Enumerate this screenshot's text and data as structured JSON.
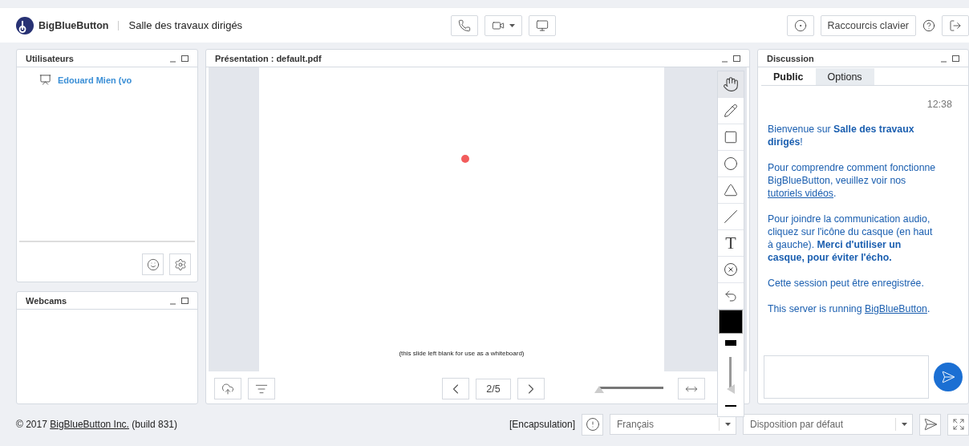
{
  "header": {
    "brand": "BigBlueButton",
    "room": "Salle des travaux dirigés",
    "media_buttons": [
      {
        "kind": "phone"
      },
      {
        "kind": "camera"
      },
      {
        "kind": "screen"
      }
    ],
    "shortcuts": "Raccourcis clavier"
  },
  "users_panel": {
    "title": "Utilisateurs",
    "users": [
      {
        "name": "Edouard Mien (vo",
        "presenter": true
      }
    ]
  },
  "webcams_panel": {
    "title": "Webcams"
  },
  "presentation": {
    "title": "Présentation : default.pdf",
    "slide_caption": "(this slide left blank for use as a whiteboard)",
    "page": "2/5",
    "zoom": {
      "level": 0
    },
    "tools": [
      {
        "kind": "hand",
        "selected": true
      },
      {
        "kind": "pencil",
        "selected": false
      },
      {
        "kind": "rectangle",
        "selected": false
      },
      {
        "kind": "ellipse",
        "selected": false
      },
      {
        "kind": "triangle",
        "selected": false
      },
      {
        "kind": "line",
        "selected": false
      },
      {
        "kind": "text",
        "label": "T",
        "selected": false
      },
      {
        "kind": "clear",
        "selected": false
      },
      {
        "kind": "undo",
        "selected": false
      }
    ],
    "pen_color": {
      "color": "#000000"
    },
    "thickness": {
      "level": 0
    }
  },
  "chat": {
    "title": "Discussion",
    "tabs": [
      {
        "label": "Public",
        "selected": true
      },
      {
        "label": "Options",
        "selected": false
      }
    ],
    "time": "12:38",
    "messages": [
      [
        {
          "kind": "text",
          "text": "Bienvenue sur "
        },
        {
          "kind": "bold",
          "text": "Salle des travaux dirigés"
        },
        {
          "kind": "text",
          "text": "!"
        }
      ],
      [
        {
          "kind": "text",
          "text": "Pour comprendre comment fonctionne BigBlueButton, veuillez voir nos "
        },
        {
          "kind": "link",
          "text": "tutoriels vidéos"
        },
        {
          "kind": "text",
          "text": "."
        }
      ],
      [
        {
          "kind": "text",
          "text": "Pour joindre la communication audio, cliquez sur l'icône du casque (en haut à gauche). "
        },
        {
          "kind": "bold",
          "text": "Merci d'utiliser un casque, pour éviter l'écho."
        }
      ],
      [
        {
          "kind": "text",
          "text": "Cette session peut être enregistrée."
        }
      ],
      [
        {
          "kind": "text",
          "text": "This server is running "
        },
        {
          "kind": "link",
          "text": "BigBlueButton"
        },
        {
          "kind": "text",
          "text": "."
        }
      ]
    ]
  },
  "footer": {
    "copyright": "© 2017 ",
    "company": "BigBlueButton Inc.",
    "build": " (build 831)",
    "tag": "[Encapsulation]",
    "language": "Français",
    "layout": "Disposition par défaut"
  }
}
